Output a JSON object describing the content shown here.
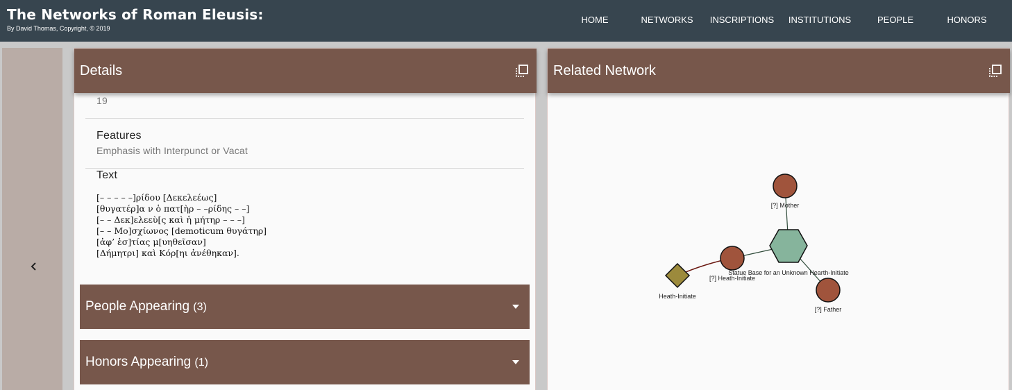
{
  "site": {
    "title": "The Networks of Roman Eleusis:",
    "subtitle": "By David Thomas, Copyright, © 2019"
  },
  "nav": {
    "items": [
      {
        "label": "HOME"
      },
      {
        "label": "NETWORKS"
      },
      {
        "label": "INSCRIPTIONS"
      },
      {
        "label": "INSTITUTIONS"
      },
      {
        "label": "PEOPLE"
      },
      {
        "label": "HONORS"
      }
    ]
  },
  "details": {
    "title": "Details",
    "partial_value": "19",
    "features_label": "Features",
    "features_value": "Emphasis with Interpunct or Vacat",
    "text_label": "Text",
    "text_lines": [
      "[– – – – –]ρίδου [Δεκελεέως]",
      "[θυγατέρ]α ν ὁ πατ[ὴρ – –ρίδης – –]",
      "[– – Δεκ]ελεεὺ[ς καὶ ἡ μήτηρ – – –]",
      "[– – Μο]σχίωνος [demoticum θυγάτηρ]",
      "[ἀφ’ ἑσ]τίας μ[υηθεῖσαν]",
      "[Δήμητρι] καὶ Κόρ[ηι ἀνέθηκαν]."
    ]
  },
  "accordions": [
    {
      "label": "People Appearing",
      "count": "(3)"
    },
    {
      "label": "Honors Appearing",
      "count": "(1)"
    }
  ],
  "network": {
    "title": "Related Network",
    "colors": {
      "person": "#a0543c",
      "institution": "#86b49c",
      "honor": "#9c8a3c"
    },
    "nodes": [
      {
        "label": "[?] Mother",
        "type": "person"
      },
      {
        "label": "Statue Base for an Unknown Hearth-Initiate",
        "type": "inscription"
      },
      {
        "label": "[?] Heath-Initiate",
        "type": "person"
      },
      {
        "label": "Heath-Initiate",
        "type": "honor"
      },
      {
        "label": "[?] Father",
        "type": "person"
      }
    ]
  },
  "colors": {
    "topbar": "#37454f",
    "header_brown": "#77574b",
    "rail": "#b9aca6"
  }
}
